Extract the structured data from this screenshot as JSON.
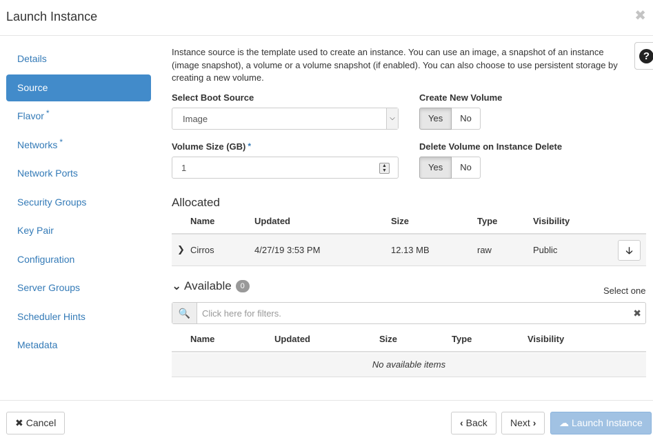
{
  "modal": {
    "title": "Launch Instance",
    "close_glyph": "✖"
  },
  "sidebar": {
    "items": [
      {
        "label": "Details",
        "required": false
      },
      {
        "label": "Source",
        "required": false,
        "active": true
      },
      {
        "label": "Flavor",
        "required": true
      },
      {
        "label": "Networks",
        "required": true
      },
      {
        "label": "Network Ports",
        "required": false
      },
      {
        "label": "Security Groups",
        "required": false
      },
      {
        "label": "Key Pair",
        "required": false
      },
      {
        "label": "Configuration",
        "required": false
      },
      {
        "label": "Server Groups",
        "required": false
      },
      {
        "label": "Scheduler Hints",
        "required": false
      },
      {
        "label": "Metadata",
        "required": false
      }
    ],
    "required_mark": "*"
  },
  "help": {
    "glyph": "?"
  },
  "intro": "Instance source is the template used to create an instance. You can use an image, a snapshot of an instance (image snapshot), a volume or a volume snapshot (if enabled). You can also choose to use persistent storage by creating a new volume.",
  "form": {
    "boot_source_label": "Select Boot Source",
    "boot_source_value": "Image",
    "create_volume_label": "Create New Volume",
    "volume_size_label": "Volume Size (GB)",
    "volume_size_value": "1",
    "delete_volume_label": "Delete Volume on Instance Delete",
    "yes": "Yes",
    "no": "No",
    "required_mark": "*"
  },
  "allocated": {
    "title": "Allocated",
    "columns": [
      "Name",
      "Updated",
      "Size",
      "Type",
      "Visibility"
    ],
    "rows": [
      {
        "name": "Cirros",
        "updated": "4/27/19 3:53 PM",
        "size": "12.13 MB",
        "type": "raw",
        "visibility": "Public"
      }
    ]
  },
  "available": {
    "title": "Available",
    "count": "0",
    "select_hint": "Select one",
    "filter_placeholder": "Click here for filters.",
    "columns": [
      "Name",
      "Updated",
      "Size",
      "Type",
      "Visibility"
    ],
    "empty_text": "No available items"
  },
  "footer": {
    "cancel": "Cancel",
    "back": "Back",
    "next": "Next",
    "launch": "Launch Instance"
  },
  "colors": {
    "accent": "#428bca",
    "link": "#337ab7",
    "launch_disabled": "#a1c2e3"
  }
}
